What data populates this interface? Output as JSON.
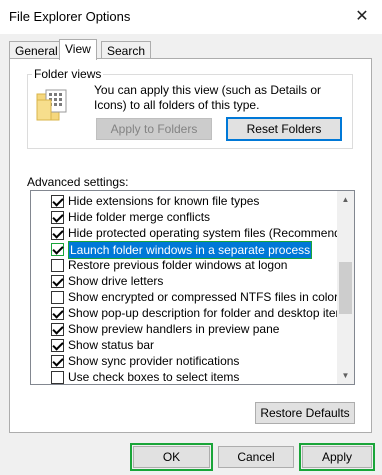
{
  "window": {
    "title": "File Explorer Options",
    "close_glyph": "✕"
  },
  "tabs": [
    {
      "label": "General",
      "active": false
    },
    {
      "label": "View",
      "active": true
    },
    {
      "label": "Search",
      "active": false
    }
  ],
  "folder_views": {
    "group_label": "Folder views",
    "description": "You can apply this view (such as Details or Icons) to all folders of this type.",
    "apply_button": "Apply to Folders",
    "reset_button": "Reset Folders"
  },
  "advanced": {
    "label": "Advanced settings:",
    "items": [
      {
        "label": "Hide extensions for known file types",
        "checked": true
      },
      {
        "label": "Hide folder merge conflicts",
        "checked": true
      },
      {
        "label": "Hide protected operating system files (Recommended)",
        "checked": true
      },
      {
        "label": "Launch folder windows in a separate process",
        "checked": true,
        "selected": true
      },
      {
        "label": "Restore previous folder windows at logon",
        "checked": false
      },
      {
        "label": "Show drive letters",
        "checked": true
      },
      {
        "label": "Show encrypted or compressed NTFS files in color",
        "checked": false
      },
      {
        "label": "Show pop-up description for folder and desktop items",
        "checked": true
      },
      {
        "label": "Show preview handlers in preview pane",
        "checked": true
      },
      {
        "label": "Show status bar",
        "checked": true
      },
      {
        "label": "Show sync provider notifications",
        "checked": true
      },
      {
        "label": "Use check boxes to select items",
        "checked": false
      }
    ],
    "restore_button": "Restore Defaults"
  },
  "footer": {
    "ok": "OK",
    "cancel": "Cancel",
    "apply": "Apply"
  }
}
